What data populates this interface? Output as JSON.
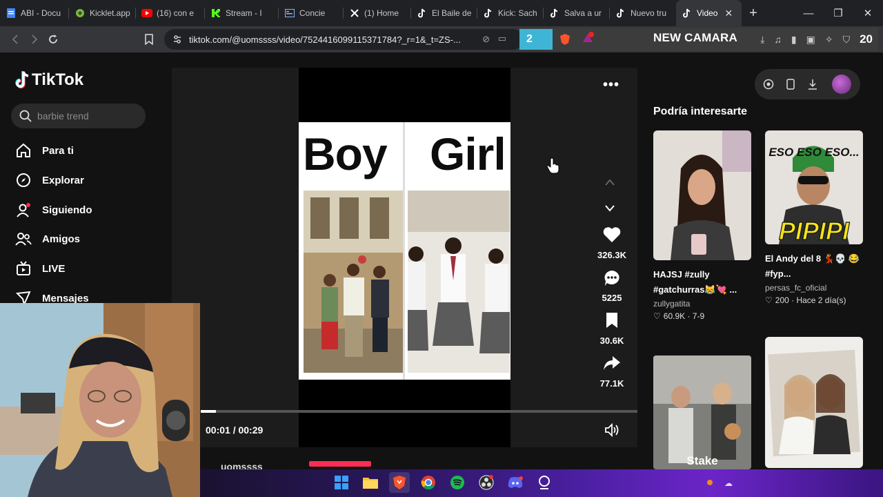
{
  "browser": {
    "tabs": [
      {
        "label": "ABI - Docu",
        "icon": "docs-icon",
        "color": "#4285f4"
      },
      {
        "label": "Kicklet.app",
        "icon": "kicklet-icon",
        "color": "#7cb342"
      },
      {
        "label": "(16) con e",
        "icon": "youtube-icon",
        "color": "#ff0000"
      },
      {
        "label": "Stream - I",
        "icon": "kick-icon",
        "color": "#53fc18"
      },
      {
        "label": "Concie",
        "icon": "window-icon",
        "color": "#8ab4f8"
      },
      {
        "label": "(1) Home",
        "icon": "x-icon",
        "color": "#ffffff"
      },
      {
        "label": "El Baile de",
        "icon": "tiktok-icon",
        "color": "#ffffff"
      },
      {
        "label": "Kick: Sach",
        "icon": "tiktok-icon",
        "color": "#ffffff"
      },
      {
        "label": "Salva a ur",
        "icon": "tiktok-icon",
        "color": "#ffffff"
      },
      {
        "label": "Nuevo tru",
        "icon": "tiktok-icon",
        "color": "#ffffff"
      },
      {
        "label": "Video",
        "icon": "tiktok-icon",
        "color": "#ffffff",
        "active": true
      }
    ],
    "url": "tiktok.com/@uomssss/video/7524416099115371784?_r=1&_t=ZS-...",
    "ext_badge": "2",
    "overlay_text": "NEW CAMARA",
    "overlay_number": "20"
  },
  "tiktok": {
    "logo": "TikTok",
    "search_placeholder": "barbie trend",
    "nav": [
      {
        "label": "Para ti",
        "icon": "home-icon"
      },
      {
        "label": "Explorar",
        "icon": "compass-icon"
      },
      {
        "label": "Siguiendo",
        "icon": "following-icon"
      },
      {
        "label": "Amigos",
        "icon": "friends-icon"
      },
      {
        "label": "LIVE",
        "icon": "live-icon"
      },
      {
        "label": "Mensajes",
        "icon": "messages-icon"
      }
    ],
    "video": {
      "caption_left": "Boy",
      "caption_right": "Girl",
      "likes": "326.3K",
      "comments": "5225",
      "saves": "30.6K",
      "shares": "77.1K",
      "time": "00:01 / 00:29",
      "progress": 0.034,
      "author": "uomssss"
    },
    "recommend_title": "Podría interesarte",
    "cards": [
      {
        "title": "HAJSJ #zully #gatchurras😹💘 ...",
        "author": "zullygatita",
        "stats": "60.9K · 7-9"
      },
      {
        "title": "El Andy del 8 💃💀 😂 #fyp...",
        "author": "persas_fc_oficial",
        "stats": "200 · Hace 2 día(s)",
        "thumb_text_top": "ESO ESO ESO...",
        "thumb_text_bottom": "PIPIPI"
      },
      {
        "title": "",
        "author": "",
        "stats": "",
        "thumb_text_bottom": "Stake"
      },
      {
        "title": "",
        "author": "",
        "stats": ""
      }
    ]
  },
  "colors": {
    "accent": "#fe2c55",
    "background": "#121212"
  }
}
